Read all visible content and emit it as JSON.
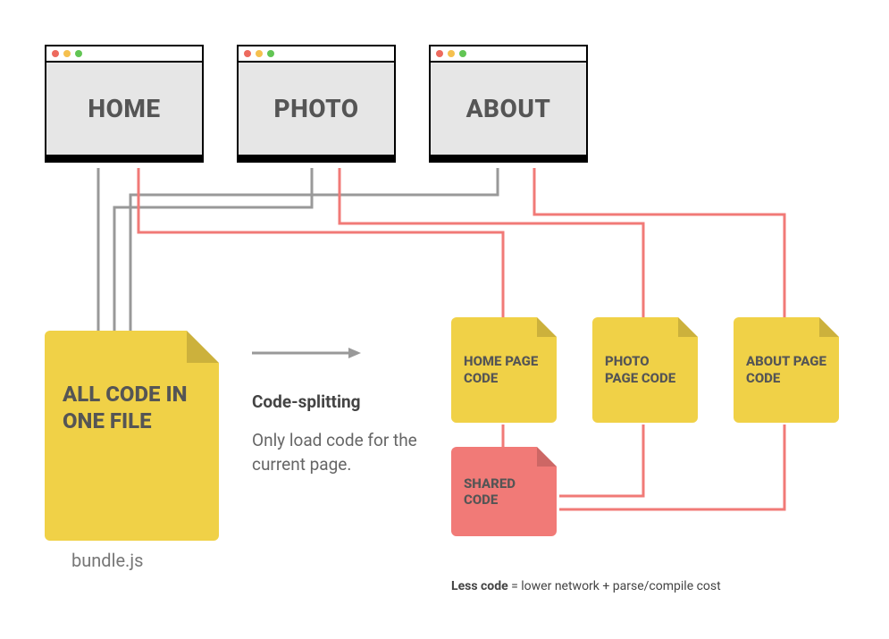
{
  "browsers": {
    "home": "HOME",
    "photo": "PHOTO",
    "about": "ABOUT"
  },
  "bundle_file": {
    "label": "ALL CODE IN ONE FILE",
    "caption": "bundle.js"
  },
  "middle": {
    "title": "Code-splitting",
    "body": "Only load code for the current page."
  },
  "chunks": {
    "home": "HOME PAGE CODE",
    "photo": "PHOTO PAGE CODE",
    "about": "ABOUT PAGE CODE",
    "shared": "SHARED CODE"
  },
  "footnote": {
    "bold": "Less code",
    "rest": " = lower network + parse/compile cost"
  }
}
